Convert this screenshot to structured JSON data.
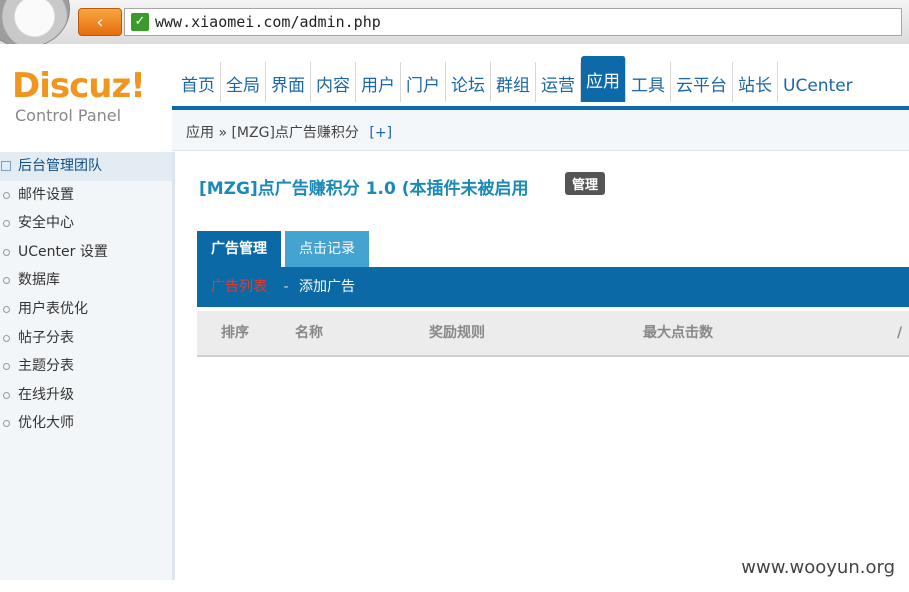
{
  "browser": {
    "back_label": "‹",
    "url": "www.xiaomei.com/admin.php"
  },
  "brand": {
    "name": "Discuz!",
    "subtitle": "Control Panel"
  },
  "top_nav": [
    {
      "label": "首页",
      "active": false
    },
    {
      "label": "全局",
      "active": false
    },
    {
      "label": "界面",
      "active": false
    },
    {
      "label": "内容",
      "active": false
    },
    {
      "label": "用户",
      "active": false
    },
    {
      "label": "门户",
      "active": false
    },
    {
      "label": "论坛",
      "active": false
    },
    {
      "label": "群组",
      "active": false
    },
    {
      "label": "运营",
      "active": false
    },
    {
      "label": "应用",
      "active": true
    },
    {
      "label": "工具",
      "active": false
    },
    {
      "label": "云平台",
      "active": false
    },
    {
      "label": "站长",
      "active": false
    },
    {
      "label": "UCenter",
      "active": false
    }
  ],
  "breadcrumb": {
    "path": "应用 » [MZG]点广告赚积分",
    "add_label": "[+]"
  },
  "sidebar": {
    "items": [
      {
        "label": "后台管理团队",
        "active": true
      },
      {
        "label": "邮件设置",
        "active": false
      },
      {
        "label": "安全中心",
        "active": false
      },
      {
        "label": "UCenter 设置",
        "active": false
      },
      {
        "label": "数据库",
        "active": false
      },
      {
        "label": "用户表优化",
        "active": false
      },
      {
        "label": "帖子分表",
        "active": false
      },
      {
        "label": "主题分表",
        "active": false
      },
      {
        "label": "在线升级",
        "active": false
      },
      {
        "label": "优化大师",
        "active": false
      }
    ]
  },
  "main": {
    "plugin_title": "[MZG]点广告赚积分 1.0 (本插件未被启用",
    "manage_label": "管理",
    "tabs": [
      {
        "label": "广告管理",
        "active": true
      },
      {
        "label": "点击记录",
        "active": false
      }
    ],
    "sub_nav": {
      "current": "广告列表",
      "separator": "-",
      "add_label": "添加广告"
    },
    "table_columns": [
      "排序",
      "名称",
      "奖励规则",
      "最大点击数",
      "/"
    ]
  },
  "colors": {
    "accent": "#0d69a8",
    "brand_orange": "#f0951f",
    "tab_inactive": "#44a3cf",
    "current_red": "#e23b2e"
  },
  "watermark": "www.wooyun.org"
}
